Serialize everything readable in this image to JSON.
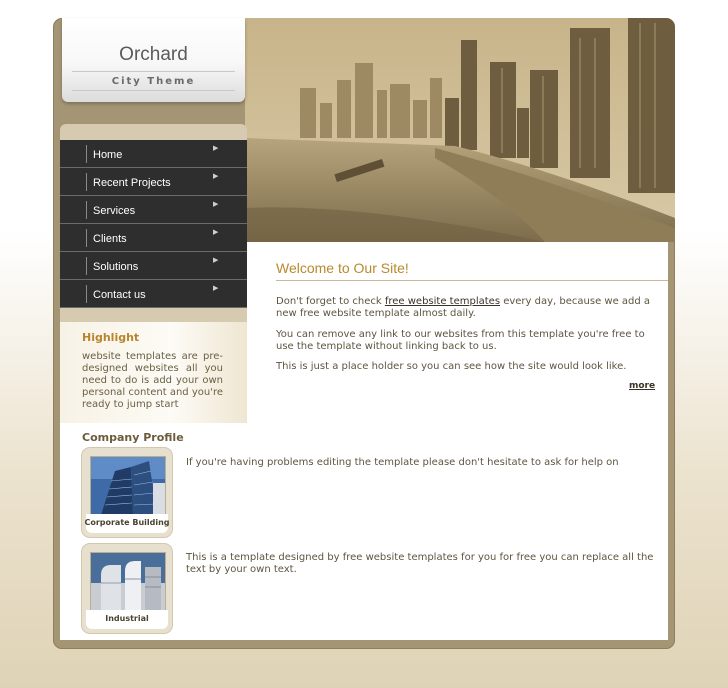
{
  "site": {
    "title": "Orchard",
    "subtitle": "City Theme"
  },
  "menu": {
    "items": [
      {
        "label": "Home"
      },
      {
        "label": "Recent Projects"
      },
      {
        "label": "Services"
      },
      {
        "label": "Clients"
      },
      {
        "label": "Solutions"
      },
      {
        "label": "Contact us"
      }
    ]
  },
  "highlight": {
    "title": "Highlight",
    "text": "website templates are pre-designed websites all you need to do is add your own personal content and you're ready to jump start"
  },
  "welcome": {
    "title": "Welcome to Our Site!",
    "p1_before": "Don't forget to check ",
    "p1_link": "free website templates",
    "p1_after": " every day, because we add a new free website template almost daily.",
    "p2": "You can remove any link to our websites from this template you're free to use the template without linking back to us.",
    "p3": "This is just a place holder so you can see how the site would look like.",
    "more": "more"
  },
  "profile": {
    "title": "Company Profile",
    "items": [
      {
        "caption": "Corporate Building",
        "text": "If you're having problems editing the template please don't hesitate to ask for help on"
      },
      {
        "caption": "Industrial",
        "text": "This is a template designed by free website templates for you for free you can replace all the text by your own text."
      }
    ]
  },
  "colors": {
    "frame": "#a49574",
    "menu_bg": "#2e2e2e",
    "accent": "#b88a2e",
    "text": "#5e5540"
  },
  "icons": {
    "menu_arrow": "arrow-right-icon"
  }
}
